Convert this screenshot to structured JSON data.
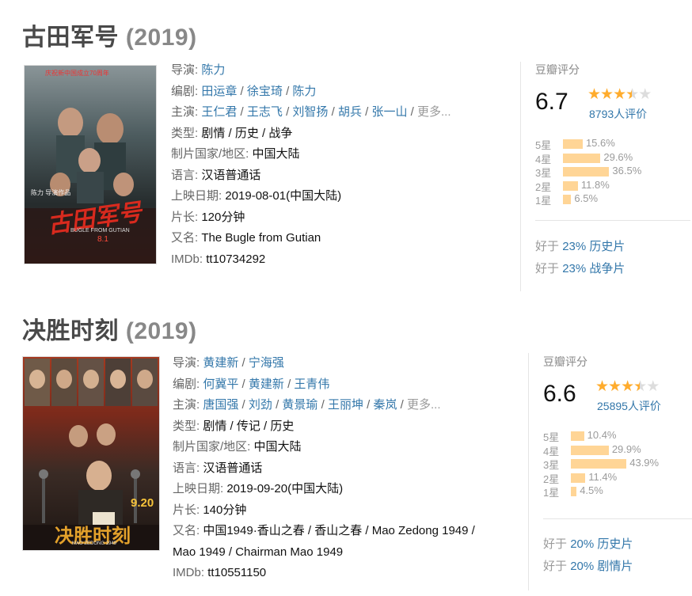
{
  "movies": [
    {
      "title": "古田军号",
      "year": "(2019)",
      "poster": {
        "top_text": "庆祝新中国成立70周年",
        "title_art": "古田军号",
        "subtitle_en": "BUGLE FROM GUTIAN",
        "date_text": "8.1",
        "credits": "陈力  导演作品"
      },
      "director_label": "导演",
      "directors": [
        "陈力"
      ],
      "writer_label": "编剧",
      "writers": [
        "田运章",
        "徐宝琦",
        "陈力"
      ],
      "cast_label": "主演",
      "cast": [
        "王仁君",
        "王志飞",
        "刘智扬",
        "胡兵",
        "张一山"
      ],
      "more": "更多...",
      "genre_label": "类型:",
      "genres": "剧情 / 历史 / 战争",
      "country_label": "制片国家/地区:",
      "country": "中国大陆",
      "language_label": "语言:",
      "language": "汉语普通话",
      "release_label": "上映日期:",
      "release": "2019-08-01(中国大陆)",
      "runtime_label": "片长:",
      "runtime": "120分钟",
      "aka_label": "又名:",
      "aka": "The Bugle from Gutian",
      "imdb_label": "IMDb:",
      "imdb": "tt10734292",
      "rating": {
        "header": "豆瓣评分",
        "score": "6.7",
        "stars": 3.5,
        "votes": "8793人评价",
        "distribution": [
          {
            "label": "5星",
            "percent": 15.6,
            "text": "15.6%"
          },
          {
            "label": "4星",
            "percent": 29.6,
            "text": "29.6%"
          },
          {
            "label": "3星",
            "percent": 36.5,
            "text": "36.5%"
          },
          {
            "label": "2星",
            "percent": 11.8,
            "text": "11.8%"
          },
          {
            "label": "1星",
            "percent": 6.5,
            "text": "6.5%"
          }
        ],
        "better_than": [
          {
            "prefix": "好于",
            "pct": "23%",
            "genre": "历史片"
          },
          {
            "prefix": "好于",
            "pct": "23%",
            "genre": "战争片"
          }
        ]
      }
    },
    {
      "title": "决胜时刻",
      "year": "(2019)",
      "poster": {
        "title_art": "决胜时刻",
        "subtitle_en": "MAO ZEDONG 1949",
        "date_text": "9.20"
      },
      "director_label": "导演",
      "directors": [
        "黄建新",
        "宁海强"
      ],
      "writer_label": "编剧",
      "writers": [
        "何冀平",
        "黄建新",
        "王青伟"
      ],
      "cast_label": "主演",
      "cast": [
        "唐国强",
        "刘劲",
        "黄景瑜",
        "王丽坤",
        "秦岚"
      ],
      "more": "更多...",
      "genre_label": "类型:",
      "genres": "剧情 / 传记 / 历史",
      "country_label": "制片国家/地区:",
      "country": "中国大陆",
      "language_label": "语言:",
      "language": "汉语普通话",
      "release_label": "上映日期:",
      "release": "2019-09-20(中国大陆)",
      "runtime_label": "片长:",
      "runtime": "140分钟",
      "aka_label": "又名:",
      "aka_line1": "中国1949·香山之春 / 香山之春 / Mao Zedong 1949 /",
      "aka_line2": "Mao 1949 / Chairman Mao 1949",
      "imdb_label": "IMDb:",
      "imdb": "tt10551150",
      "rating": {
        "header": "豆瓣评分",
        "score": "6.6",
        "stars": 3.5,
        "votes": "25895人评价",
        "distribution": [
          {
            "label": "5星",
            "percent": 10.4,
            "text": "10.4%"
          },
          {
            "label": "4星",
            "percent": 29.9,
            "text": "29.9%"
          },
          {
            "label": "3星",
            "percent": 43.9,
            "text": "43.9%"
          },
          {
            "label": "2星",
            "percent": 11.4,
            "text": "11.4%"
          },
          {
            "label": "1星",
            "percent": 4.5,
            "text": "4.5%"
          }
        ],
        "better_than": [
          {
            "prefix": "好于",
            "pct": "20%",
            "genre": "历史片"
          },
          {
            "prefix": "好于",
            "pct": "20%",
            "genre": "剧情片"
          }
        ]
      }
    }
  ],
  "colors": {
    "link": "#3377aa",
    "star": "#ffac2d",
    "bar": "#ffd596",
    "label": "#666666"
  }
}
